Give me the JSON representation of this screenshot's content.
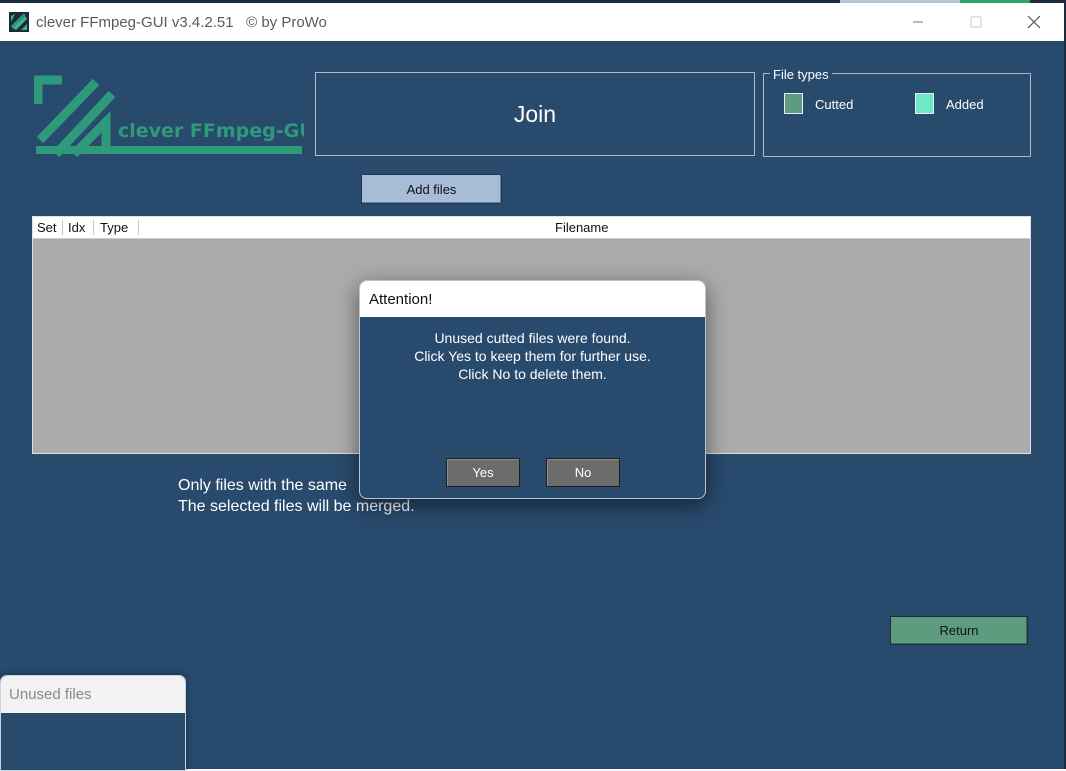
{
  "window": {
    "title": "clever FFmpeg-GUI v3.4.2.51",
    "copyright": "© by ProWo"
  },
  "logo": {
    "text": "clever FFmpeg-GUI",
    "color": "#2e9a7a"
  },
  "mode_title": "Join",
  "file_types": {
    "legend": "File types",
    "items": [
      {
        "label": "Cutted",
        "color": "#5e9c80"
      },
      {
        "label": "Added",
        "color": "#6fe8c8"
      }
    ]
  },
  "add_files_label": "Add files",
  "table": {
    "columns": [
      "Set",
      "Idx",
      "Type",
      "Filename"
    ],
    "rows": []
  },
  "info": {
    "line1": "Only files with the same",
    "line2": "The selected files will be merged."
  },
  "return_label": "Return",
  "unused_panel": {
    "title": "Unused files"
  },
  "dialog": {
    "title": "Attention!",
    "lines": [
      "Unused cutted files were found.",
      "Click Yes to keep them for further use.",
      "Click No to delete them."
    ],
    "yes_label": "Yes",
    "no_label": "No"
  },
  "colors": {
    "background": "#284a6d",
    "accent": "#5e9c80",
    "button_blue": "#a7bcd7"
  }
}
